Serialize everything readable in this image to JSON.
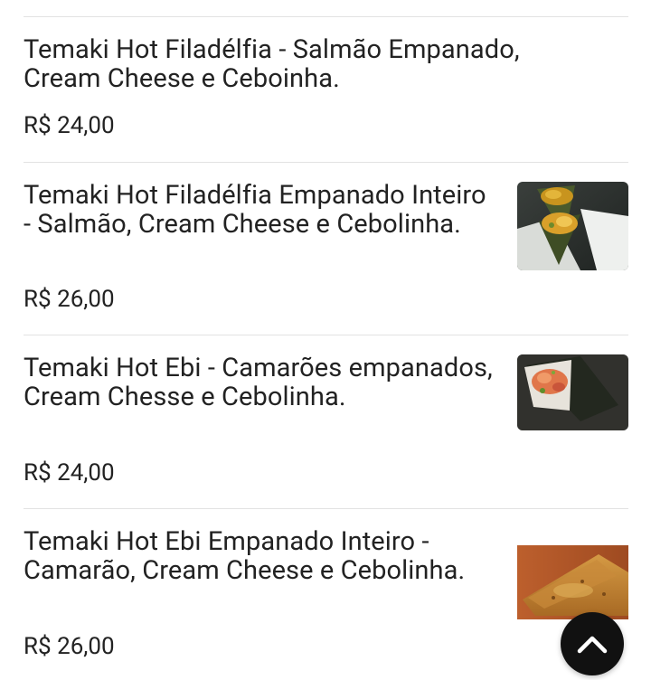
{
  "menu": {
    "items": [
      {
        "name": "Temaki Hot Filadélfia - Salmão Empanado, Cream Cheese e Ceboinha.",
        "price": "R$ 24,00"
      },
      {
        "name": "Temaki Hot Filadélfia Empanado Inteiro - Salmão, Cream Cheese e Cebolinha.",
        "price": "R$ 26,00",
        "image": "temaki-salmon-cone-photo"
      },
      {
        "name": "Temaki Hot Ebi - Camarões empanados, Cream Chesse e Cebolinha.",
        "price": "R$ 24,00",
        "image": "temaki-shrimp-cone-photo"
      },
      {
        "name": "Temaki Hot Ebi Empanado Inteiro - Camarão, Cream Cheese e Cebolinha.",
        "price": "R$ 26,00",
        "image": "breaded-shrimp-temaki-photo"
      }
    ]
  },
  "scroll_top_button": {
    "icon": "chevron-up-icon",
    "background": "#111111",
    "icon_color": "#ffffff"
  },
  "colors": {
    "text": "#222222",
    "divider": "#e2e2e2",
    "background": "#ffffff"
  }
}
